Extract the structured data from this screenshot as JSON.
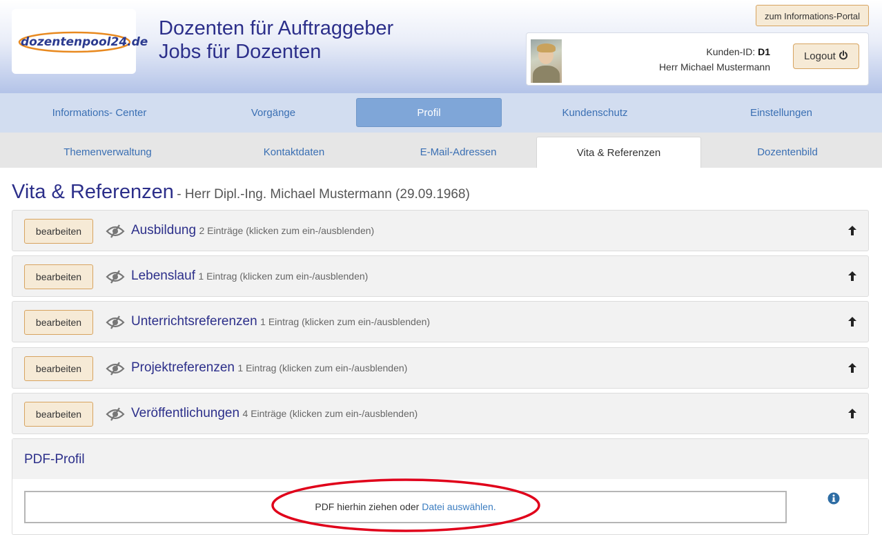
{
  "header": {
    "logo_text": "dozentenpool24.de",
    "title_line1": "Dozenten für Auftraggeber",
    "title_line2": "Jobs für Dozenten",
    "portal_button": "zum Informations-Portal",
    "customer_id_label": "Kunden-ID:",
    "customer_id_value": "D1",
    "user_name": "Herr Michael Mustermann",
    "logout_label": "Logout"
  },
  "nav_main": [
    {
      "label": "Informations- Center"
    },
    {
      "label": "Vorgänge"
    },
    {
      "label": "Profil"
    },
    {
      "label": "Kundenschutz"
    },
    {
      "label": "Einstellungen"
    }
  ],
  "nav_sub": [
    {
      "label": "Themenverwaltung"
    },
    {
      "label": "Kontaktdaten"
    },
    {
      "label": "E-Mail-Adressen"
    },
    {
      "label": "Vita & Referenzen"
    },
    {
      "label": "Dozentenbild"
    }
  ],
  "page": {
    "title": "Vita & Referenzen",
    "subtitle": "- Herr Dipl.-Ing. Michael Mustermann (29.09.1968)"
  },
  "sections": [
    {
      "edit_label": "bearbeiten",
      "name": "Ausbildung",
      "count": "2 Einträge (klicken zum ein-/ausblenden)"
    },
    {
      "edit_label": "bearbeiten",
      "name": "Lebenslauf",
      "count": "1 Eintrag (klicken zum ein-/ausblenden)"
    },
    {
      "edit_label": "bearbeiten",
      "name": "Unterrichtsreferenzen",
      "count": "1 Eintrag (klicken zum ein-/ausblenden)"
    },
    {
      "edit_label": "bearbeiten",
      "name": "Projektreferenzen",
      "count": "1 Eintrag (klicken zum ein-/ausblenden)"
    },
    {
      "edit_label": "bearbeiten",
      "name": "Veröffentlichungen",
      "count": "4 Einträge (klicken zum ein-/ausblenden)"
    }
  ],
  "pdf": {
    "title": "PDF-Profil",
    "drop_text": "PDF hierhin ziehen oder",
    "drop_link": "Datei auswählen."
  },
  "icons": {
    "visibility": "eye-slash-icon",
    "collapse": "arrow-up-icon",
    "info": "info-circle-icon",
    "power": "power-icon"
  },
  "colors": {
    "brand_blue": "#2c2f8a",
    "link_blue": "#3a6fb3",
    "button_bg": "#f6ead6",
    "button_border": "#d7a35f",
    "nav_active": "#7fa6d8",
    "annotation_red": "#e0001a"
  }
}
